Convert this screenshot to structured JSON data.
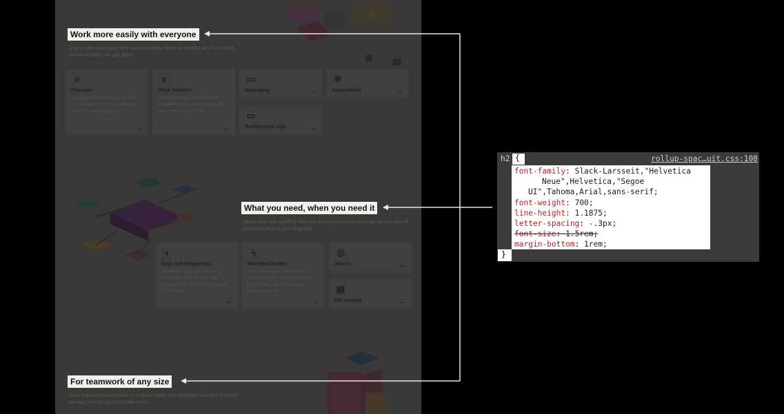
{
  "headings": {
    "h1": "Work more easily with everyone",
    "h2": "What you need, when you need it",
    "h3": "For teamwork of any size"
  },
  "subtexts": {
    "s1": "Stay on the same page and make decisions faster by bringing all of your work communication into one place",
    "s2": "Spend less time shuffling tabs with a comprehensive message archive and all your work tools at your fingertips.",
    "s3": "Slack supports collaboration at a global scale, with unlimited channels to mirror the way your company actually works."
  },
  "cards_top": [
    {
      "icon": "#",
      "title": "Channels",
      "desc": "Stay organized and focused with central spaces for conversations, files, tools and people."
    },
    {
      "icon": "#",
      "title": "Slack Connect",
      "desc": "Collaborate with teams at other companies the same way you do with teams at your own."
    },
    {
      "icon": "▭",
      "title": "Messaging",
      "desc": ""
    },
    {
      "icon": "✲",
      "title": "Accessibility",
      "desc": ""
    },
    {
      "icon": "▭",
      "title": "Huddles and clips",
      "desc": ""
    }
  ],
  "cards_bottom": [
    {
      "icon": "+",
      "title": "Apps and integrations",
      "desc": "Streamline work by connecting Slack with other services like Google Drive, Office 365 and over 2,500 more."
    },
    {
      "icon": "ϟ",
      "title": "Workflow Builder",
      "desc": "Automate routine actions and communication, so you can get back to the kind of work only humans can do."
    },
    {
      "icon": "◎",
      "title": "Search",
      "desc": ""
    },
    {
      "icon": "▤",
      "title": "File sharing",
      "desc": ""
    }
  ],
  "arrow_glyph": "→",
  "devtools": {
    "selector": "h2",
    "open_brace": "{",
    "close_brace": "}",
    "source": "rollup-spac…uit.css:108",
    "lines": [
      {
        "prop": "font-family",
        "value": "Slack-Larsseit,\"Helvetica",
        "strike": false
      },
      {
        "prop": "",
        "value": "    Neue\",Helvetica,\"Segoe",
        "strike": false
      },
      {
        "prop": "",
        "value": "UI\",Tahoma,Arial,sans-serif;",
        "strike": false
      },
      {
        "prop": "font-weight",
        "value": "700;",
        "strike": false
      },
      {
        "prop": "line-height",
        "value": "1.1875;",
        "strike": false
      },
      {
        "prop": "letter-spacing",
        "value": "-.3px;",
        "strike": false
      },
      {
        "prop": "font-size",
        "value": "1.5rem;",
        "strike": true
      },
      {
        "prop": "margin-bottom",
        "value": "1rem;",
        "strike": false
      }
    ]
  },
  "colors": {
    "page_bg": "#3a3937",
    "outer_bg": "#000000",
    "highlight": "#f2f0ec",
    "css_prop": "#b81f1f"
  }
}
